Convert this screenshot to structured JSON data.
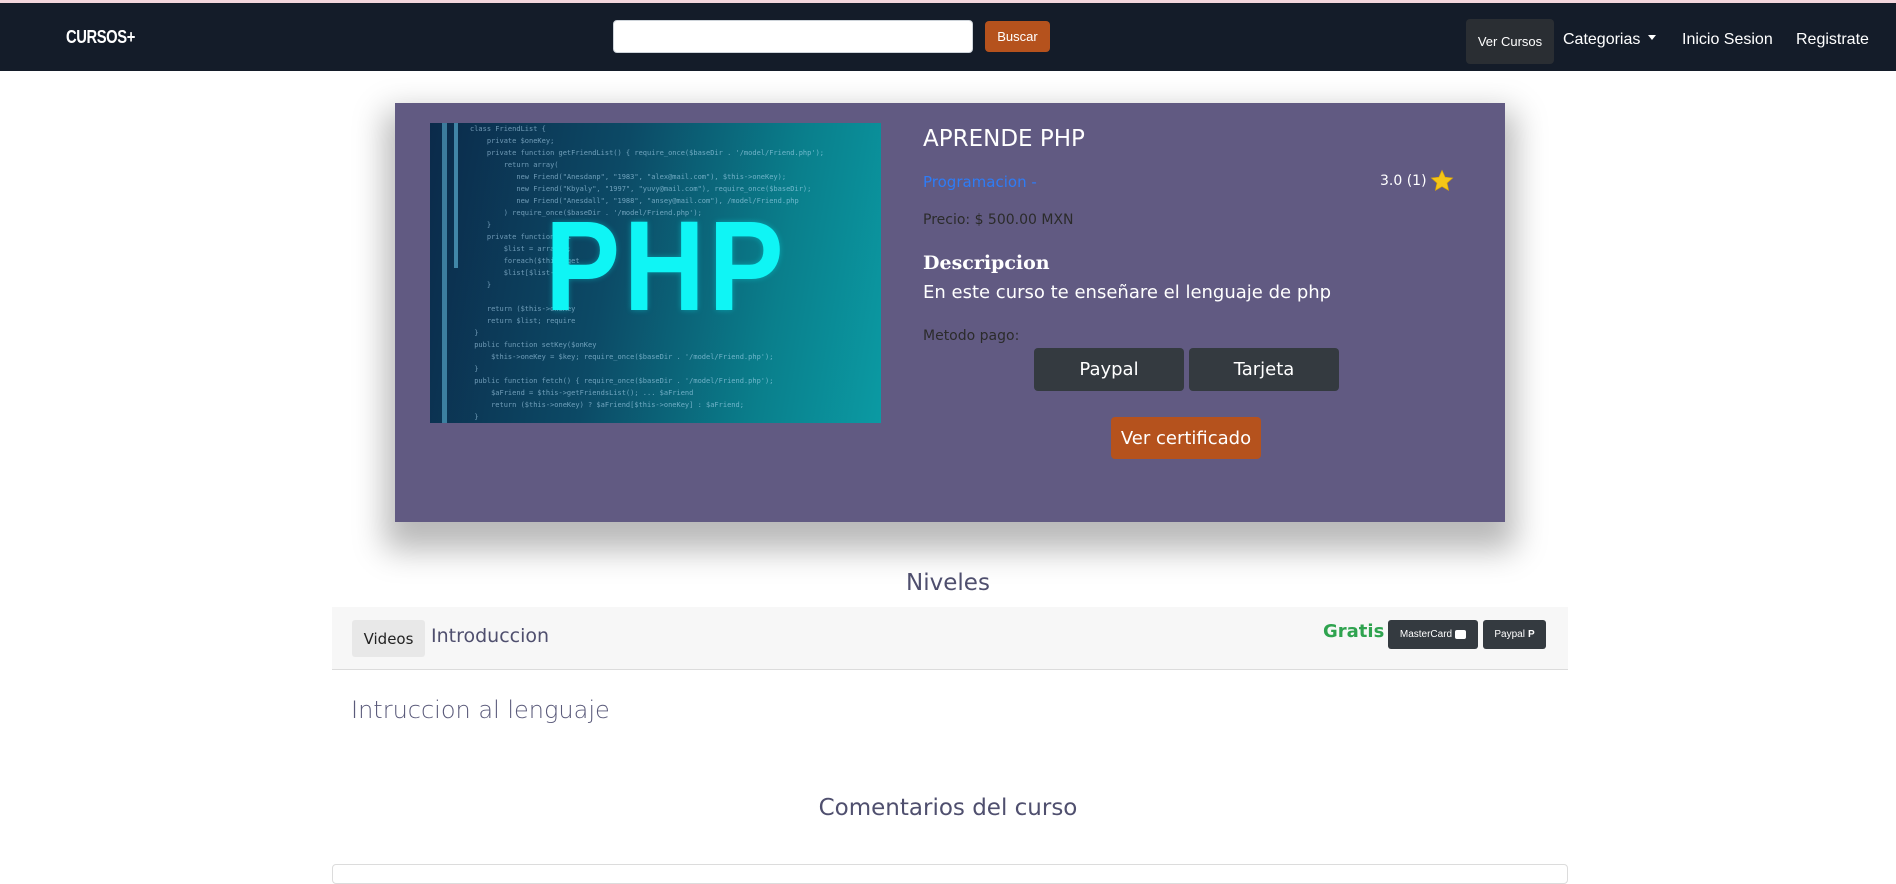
{
  "navbar": {
    "brand": "CURSOS+",
    "search_placeholder": "",
    "search_button": "Buscar",
    "links": {
      "ver_cursos": "Ver Cursos",
      "categorias": "Categorias",
      "inicio_sesion": "Inicio Sesion",
      "registrate": "Registrate"
    }
  },
  "course": {
    "image_text": "PHP",
    "title": "APRENDE PHP",
    "category": "Programacion -",
    "rating": "3.0 (1)",
    "price": "Precio: $ 500.00 MXN",
    "description_heading": "Descripcion",
    "description": "En este curso te enseñare el lenguaje de php",
    "payment_label": "Metodo pago:",
    "payment_buttons": [
      "Paypal",
      "Tarjeta"
    ],
    "certificate_button": "Ver certificado"
  },
  "levels": {
    "heading": "Niveles",
    "items": [
      {
        "videos_button": "Videos",
        "name": "Introduccion",
        "price_label": "Gratis",
        "pay_buttons": [
          "MasterCard",
          "Paypal"
        ],
        "description": "Intruccion al lenguaje"
      }
    ]
  },
  "comments": {
    "heading": "Comentarios del curso"
  },
  "colors": {
    "navbar": "#141c29",
    "card": "#615a82",
    "accent": "#b5521d",
    "dark_button": "#343a40",
    "free": "#2fa34f",
    "link": "#2e7cf6",
    "star": "#f5c518"
  }
}
